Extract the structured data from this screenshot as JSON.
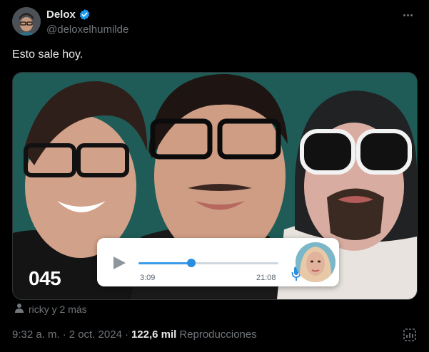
{
  "author": {
    "display_name": "Delox",
    "handle": "@deloxelhumilde",
    "avatar_icon": "profile-photo",
    "verified_color": "#1d9bf0"
  },
  "tweet": {
    "text": "Esto sale hoy."
  },
  "media": {
    "background_color": "#1d5e58",
    "episode_number": "045",
    "player": {
      "current_time": "3:09",
      "total_time": "21:08",
      "progress": 0.38,
      "accent_color": "#2a8de0"
    }
  },
  "tagged": {
    "icon": "person-icon",
    "label": "ricky y 2 más"
  },
  "meta": {
    "time": "9:32 a. m.",
    "separator1": "·",
    "date": "2 oct. 2024",
    "separator2": "·",
    "views": "122,6 mil",
    "views_label": "Reproducciones"
  }
}
